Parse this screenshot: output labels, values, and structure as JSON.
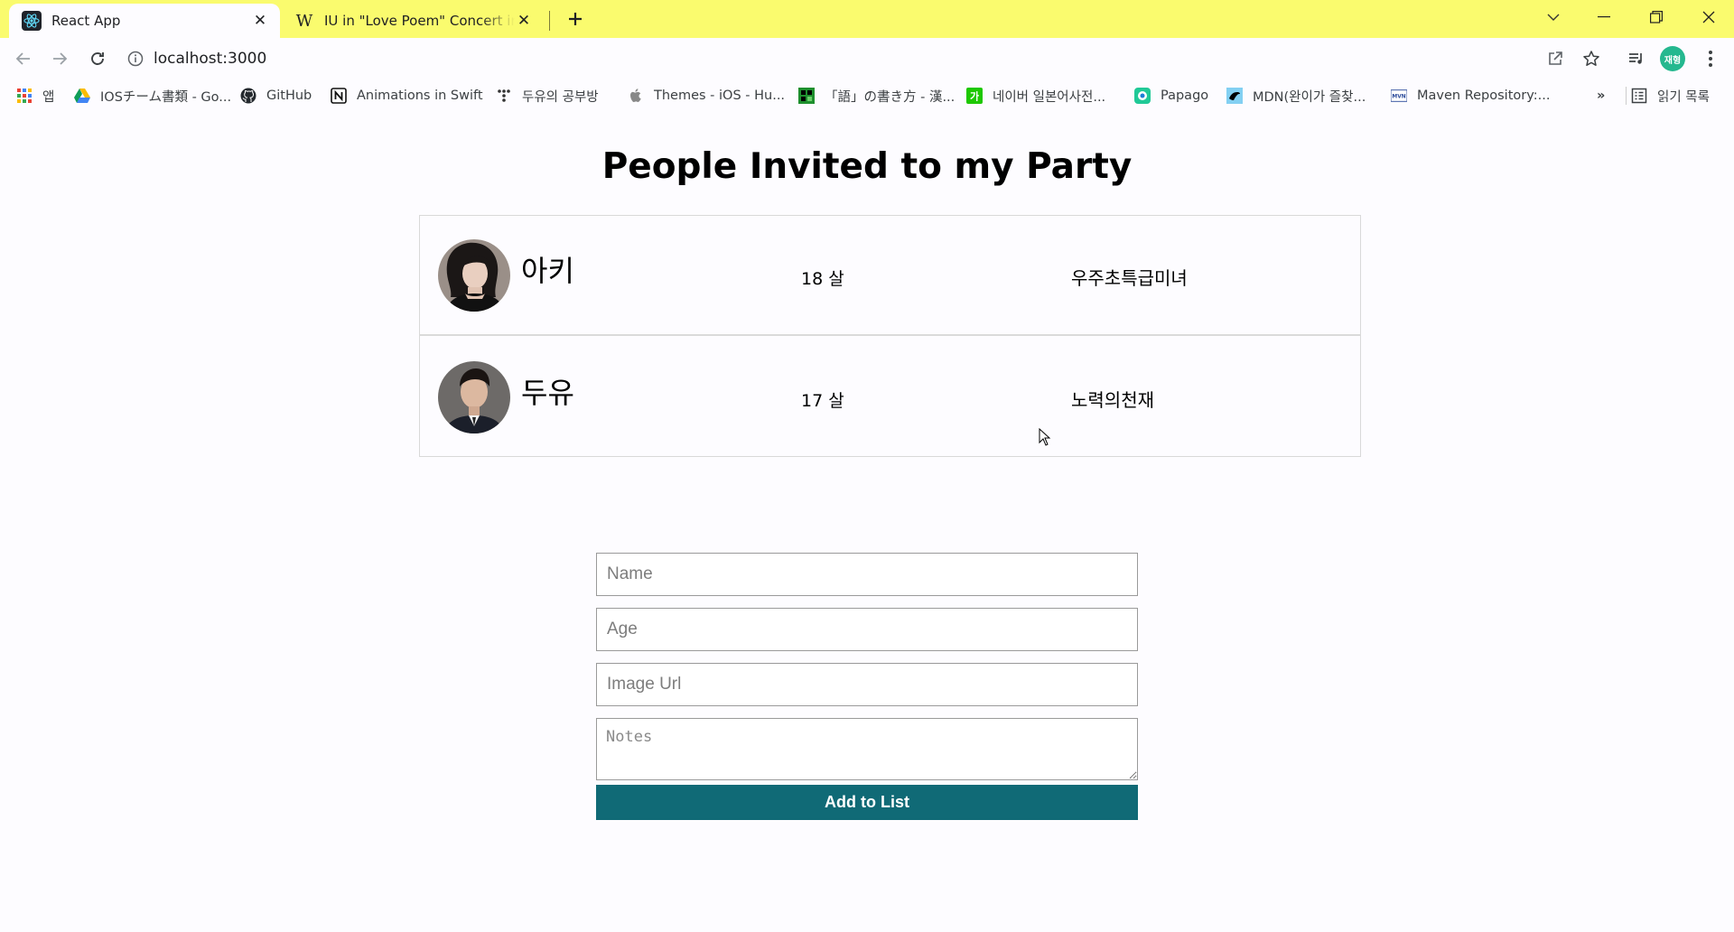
{
  "browser": {
    "tabs": [
      {
        "title": "React App",
        "active": true,
        "icon": "react-icon"
      },
      {
        "title": "IU in \"Love Poem\" Concert in S",
        "active": false,
        "icon": "wikipedia-icon"
      }
    ],
    "url": "localhost:3000",
    "profile_initials": "재형",
    "accent_colors": {
      "tabstrip": "#fafb6e",
      "profile": "#25b88f"
    }
  },
  "bookmarks": {
    "items": [
      {
        "label": "앱",
        "icon": "apps-grid-icon"
      },
      {
        "label": "IOSチーム書類 - Go...",
        "icon": "google-drive-icon"
      },
      {
        "label": "GitHub",
        "icon": "github-icon"
      },
      {
        "label": "Animations in Swift",
        "icon": "notion-icon"
      },
      {
        "label": "두유의 공부방",
        "icon": "dots-icon"
      },
      {
        "label": "Themes - iOS - Hu...",
        "icon": "apple-icon"
      },
      {
        "label": "「語」の書き方 - 漢...",
        "icon": "kanji-site-icon"
      },
      {
        "label": "네이버 일본어사전...",
        "icon": "naver-dict-icon"
      },
      {
        "label": "Papago",
        "icon": "papago-icon"
      },
      {
        "label": "MDN(완이가 즐찾...",
        "icon": "mdn-icon"
      },
      {
        "label": "Maven Repository:...",
        "icon": "maven-icon"
      }
    ],
    "overflow": "»",
    "reading_list": "읽기 목록"
  },
  "page": {
    "title": "People Invited to my Party",
    "people": [
      {
        "name": "아키",
        "age": "18 살",
        "note": "우주초특급미녀"
      },
      {
        "name": "두유",
        "age": "17 살",
        "note": "노력의천재"
      }
    ],
    "form": {
      "name_placeholder": "Name",
      "age_placeholder": "Age",
      "image_placeholder": "Image Url",
      "notes_placeholder": "Notes",
      "submit_label": "Add to List"
    },
    "button_color": "#106a76"
  }
}
